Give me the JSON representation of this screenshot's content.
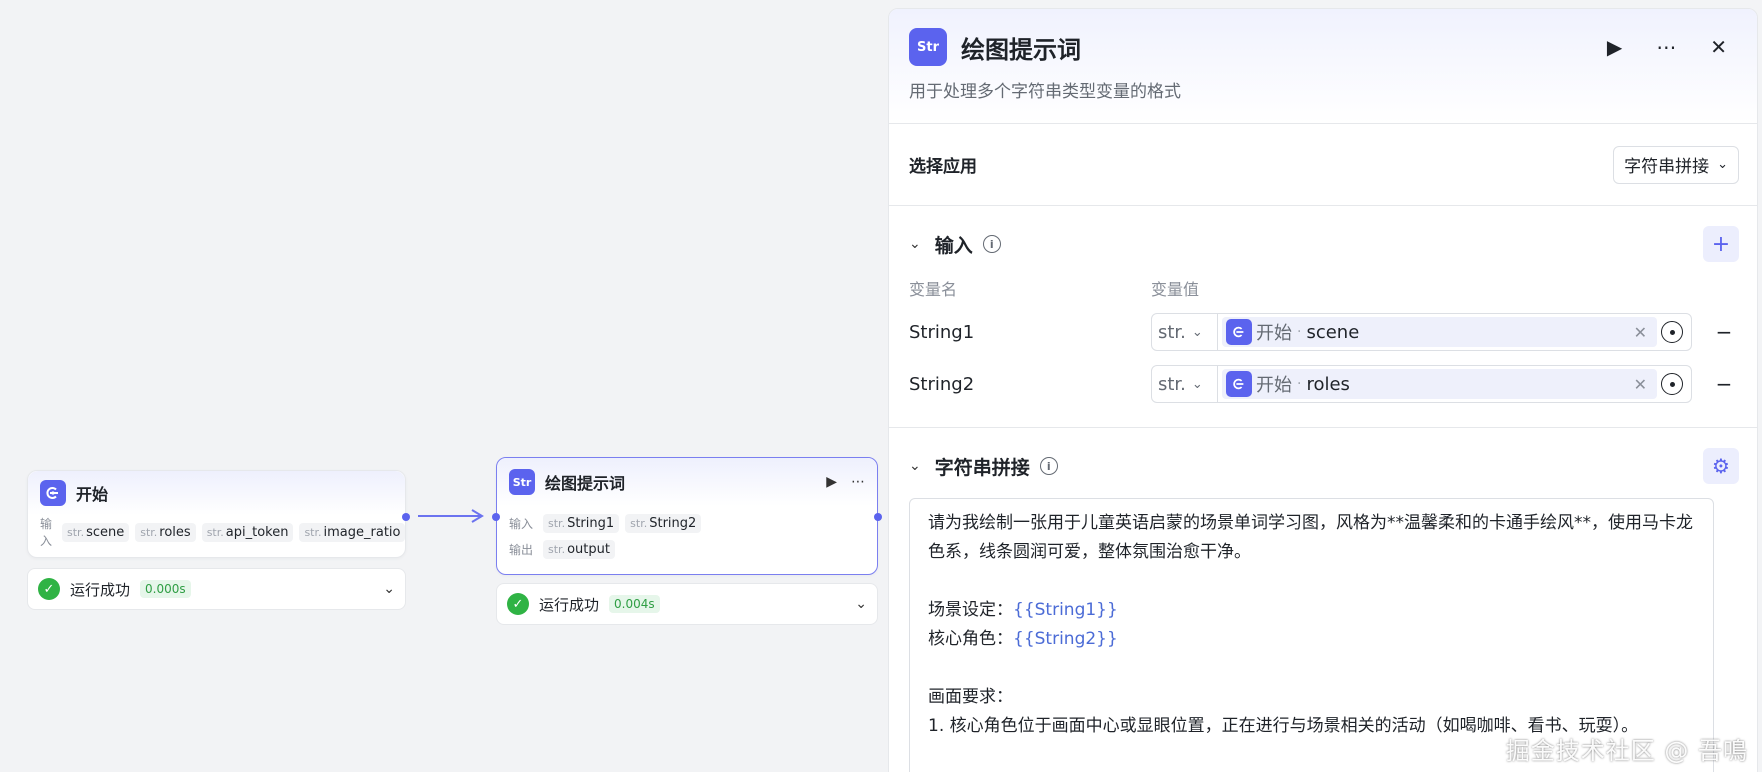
{
  "canvas": {
    "start_node": {
      "title": "开始",
      "icon": "start-node-icon",
      "input_label": "输入",
      "type_prefix": "str.",
      "inputs": [
        "scene",
        "roles",
        "api_token",
        "image_ratio"
      ],
      "status": {
        "text": "运行成功",
        "time": "0.000s"
      }
    },
    "prompt_node": {
      "title": "绘图提示词",
      "icon": "string-node-icon",
      "input_label": "输入",
      "output_label": "输出",
      "type_prefix": "str.",
      "inputs": [
        "String1",
        "String2"
      ],
      "outputs": [
        "output"
      ],
      "status": {
        "text": "运行成功",
        "time": "0.004s"
      }
    }
  },
  "panel": {
    "title": "绘图提示词",
    "icon_text": "Str",
    "description": "用于处理多个字符串类型变量的格式",
    "app_section": {
      "label": "选择应用",
      "selected": "字符串拼接"
    },
    "input_section": {
      "title": "输入",
      "col_name": "变量名",
      "col_value": "变量值",
      "rows": [
        {
          "name": "String1",
          "type": "str.",
          "ref_node": "开始",
          "ref_var": "scene"
        },
        {
          "name": "String2",
          "type": "str.",
          "ref_node": "开始",
          "ref_var": "roles"
        }
      ]
    },
    "concat_section": {
      "title": "字符串拼接",
      "lines": {
        "l1": "请为我绘制一张用于儿童英语启蒙的场景单词学习图，风格为**温馨柔和的卡通手绘风**，使用马卡龙色系，线条圆润可爱，整体氛围治愈干净。",
        "l2_label": "场景设定：",
        "l2_tpl": "{{String1}}",
        "l3_label": "核心角色：",
        "l3_tpl": "{{String2}}",
        "l4": "画面要求：",
        "l5": "1. 核心角色位于画面中心或显眼位置，正在进行与场景相关的活动（如喝咖啡、看书、玩耍）。"
      }
    }
  },
  "watermark": "掘金技术社区 @ 吾鳴",
  "colors": {
    "accent": "#5b63ee",
    "success": "#2fb344",
    "template": "#4b6bd6"
  }
}
